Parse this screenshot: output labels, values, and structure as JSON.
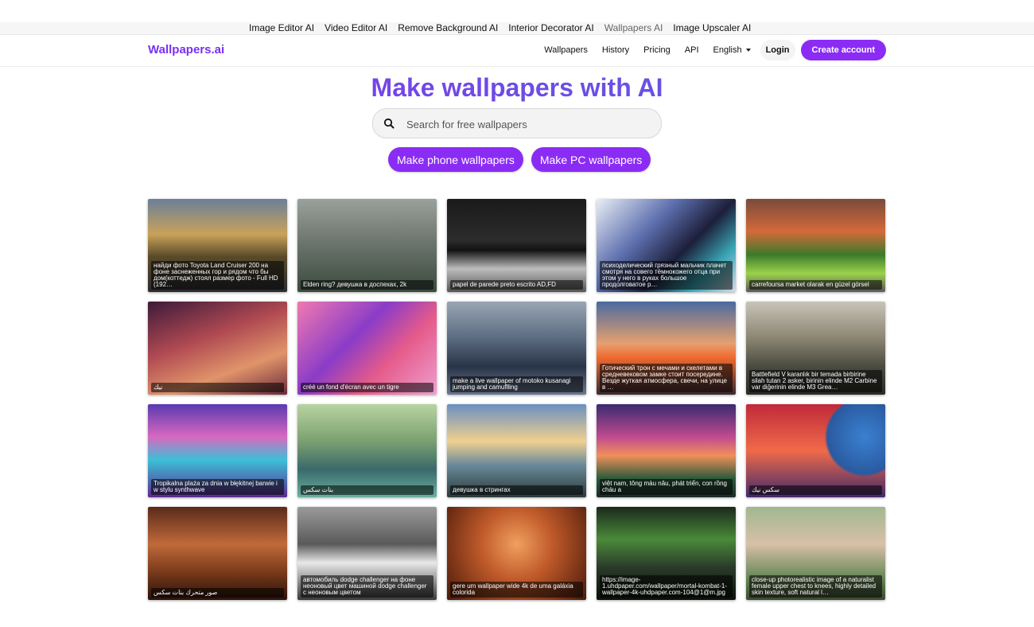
{
  "topbar": {
    "links": [
      {
        "label": "Image Editor AI"
      },
      {
        "label": "Video Editor AI"
      },
      {
        "label": "Remove Background AI"
      },
      {
        "label": "Interior Decorator AI"
      },
      {
        "label": "Wallpapers AI"
      },
      {
        "label": "Image Upscaler AI"
      }
    ]
  },
  "navbar": {
    "brand": "Wallpapers.ai",
    "links": [
      "Wallpapers",
      "History",
      "Pricing",
      "API"
    ],
    "language": "English",
    "login": "Login",
    "create_account": "Create account"
  },
  "hero": {
    "title": "Make wallpapers with AI",
    "search_placeholder": "Search for free wallpapers",
    "phone_button": "Make phone wallpapers",
    "pc_button": "Make PC wallpapers"
  },
  "colors": {
    "accent": "#8b2cf5",
    "brand": "#7b2ff7"
  },
  "gallery": [
    {
      "caption": "найди фото Toyota Land Cruiser 200 на фоне заснеженных гор и рядом что бы дом(коттедж) стоял размер фото - Full HD (192…"
    },
    {
      "caption": "Elden ring? девушка в доспехах, 2k"
    },
    {
      "caption": "papel de parede preto escrito AD,FD"
    },
    {
      "caption": "психоделический грязный мальчик плачет смотря на совего тёмнокожего отца при этом у него в руках большое продолговатое р…"
    },
    {
      "caption": "carrefoursa market olarak en güzel görsel"
    },
    {
      "caption": "نيك"
    },
    {
      "caption": "créé un fond d'écran avec un tigre"
    },
    {
      "caption": "make a live wallpaper of motoko kusanagi jumping and camuflling"
    },
    {
      "caption": "Готический трон с мечами и скелетами в средневековом замке стоит посередине. Везде жуткая атмосфера, свечи, на улице в …"
    },
    {
      "caption": "Battlefield V karanlık bir temada birbirine silah tutan 2 asker, birinin elinde M2 Carbine var diğerinin elinde M3 Grea…"
    },
    {
      "caption": "Tropikalna plaża za dnia w błękitnej barwie i w stylu synthwave"
    },
    {
      "caption": "بنات سكس"
    },
    {
      "caption": "девушка в стрингах"
    },
    {
      "caption": "việt nam, tông màu nâu, phát triển, con rồng cháu a"
    },
    {
      "caption": "سكس نيك"
    },
    {
      "caption": "صور متحرك بنات سكس"
    },
    {
      "caption": "автомобиль dodge challenger на фоне неоновый цвет машиной dodge challenger с неоновым цветом"
    },
    {
      "caption": "gere um wallpaper wide 4k de uma galáxia colorida"
    },
    {
      "caption": "https://image-1.uhdpaper.com/wallpaper/mortal-kombat-1-wallpaper-4k-uhdpaper.com-104@1@m.jpg"
    },
    {
      "caption": "close-up photorealistic image of a naturalist female upper chest to knees, highly detailed skin texture, soft natural l…"
    }
  ]
}
